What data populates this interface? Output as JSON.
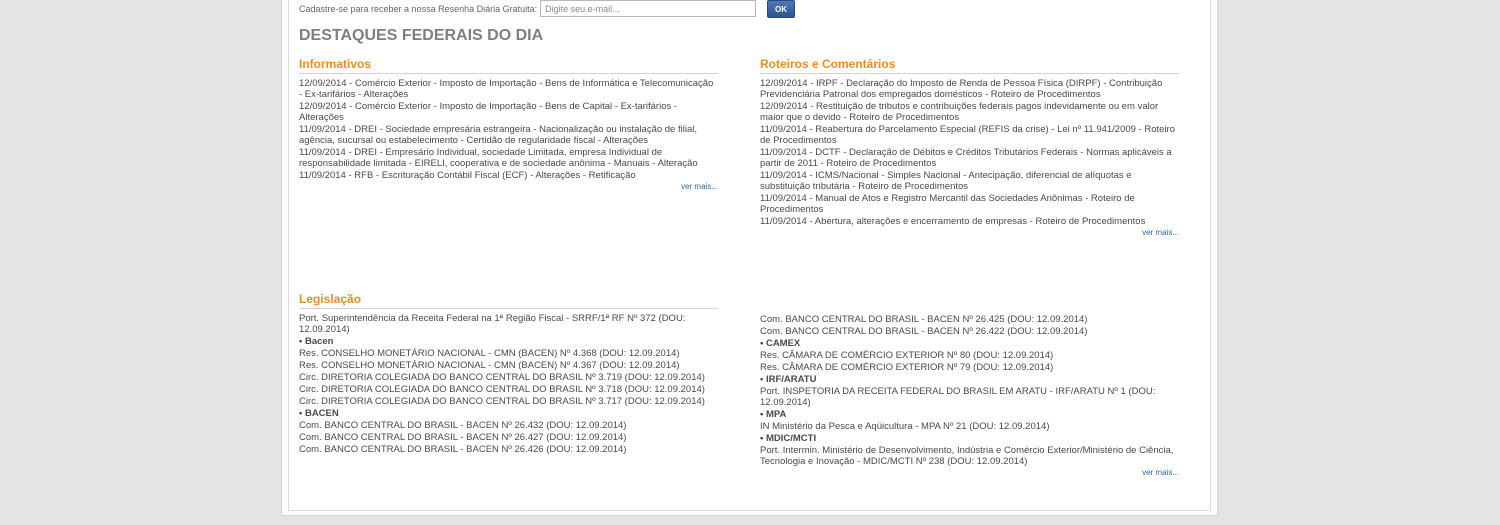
{
  "newsletter": {
    "label": "Cadastre-se para receber a nossa Resenha Diária Gratuita:",
    "placeholder": "Digite seu e-mail...",
    "ok_label": "OK"
  },
  "title": "DESTAQUES FEDERAIS DO DIA",
  "informativos": {
    "title": "Informativos",
    "items": [
      "12/09/2014 - Comércio Exterior - Imposto de Importação - Bens de Informática e Telecomunicação - Ex-tarifários - Alterações",
      "12/09/2014 - Comércio Exterior - Imposto de Importação - Bens de Capital - Ex-tarifários - Alterações",
      "11/09/2014 - DREI - Sociedade empresária estrangeira - Nacionalização ou instalação de filial, agência, sucursal ou estabelecimento - Certidão de regularidade fiscal - Alterações",
      "11/09/2014 - DREI - Empresário Individual, sociedade Limitada, empresa Individual de responsabilidade limitada - EIRELI, cooperativa e de sociedade anônima - Manuais - Alteração",
      "11/09/2014 - RFB - Escrituração Contábil Fiscal (ECF) - Alterações - Retificação"
    ],
    "more": "ver mais..."
  },
  "roteiros": {
    "title": "Roteiros e Comentários",
    "items": [
      "12/09/2014 - IRPF - Declaração do Imposto de Renda de Pessoa Física (DIRPF) - Contribuição Previdenciária Patronal dos empregados domésticos - Roteiro de Procedimentos",
      "12/09/2014 - Restituição de tributos e contribuições federais pagos indevidamente ou em valor maior que o devido - Roteiro de Procedimentos",
      "11/09/2014 - Reabertura do Parcelamento Especial (REFIS da crise) - Lei nº 11.941/2009 - Roteiro de Procedimentos",
      "11/09/2014 - DCTF - Declaração de Débitos e Créditos Tributários Federais - Normas aplicáveis a partir de 2011 - Roteiro de Procedimentos",
      "11/09/2014 - ICMS/Nacional - Simples Nacional - Antecipação, diferencial de alíquotas e substituição tributária - Roteiro de Procedimentos",
      "11/09/2014 - Manual de Atos e Registro Mercantil das Sociedades Anônimas - Roteiro de Procedimentos",
      "11/09/2014 - Abertura, alterações e encerramento de empresas - Roteiro de Procedimentos"
    ],
    "more": "ver mais..."
  },
  "legislacao": {
    "title": "Legislação",
    "left_entries": [
      {
        "kind": "item",
        "text": "Port. Superintendência da Receita Federal na 1ª Região Fiscal - SRRF/1ª RF Nº 372 (DOU: 12.09.2014)"
      },
      {
        "kind": "group",
        "text": "• Bacen"
      },
      {
        "kind": "item",
        "text": "Res. CONSELHO MONETÁRIO NACIONAL - CMN (BACEN) Nº 4.368 (DOU: 12.09.2014)"
      },
      {
        "kind": "item",
        "text": "Res. CONSELHO MONETÁRIO NACIONAL - CMN (BACEN) Nº 4.367 (DOU: 12.09.2014)"
      },
      {
        "kind": "item",
        "text": "Circ. DIRETORIA COLEGIADA DO BANCO CENTRAL DO BRASIL Nº 3.719 (DOU: 12.09.2014)"
      },
      {
        "kind": "item",
        "text": "Circ. DIRETORIA COLEGIADA DO BANCO CENTRAL DO BRASIL Nº 3.718 (DOU: 12.09.2014)"
      },
      {
        "kind": "item",
        "text": "Circ. DIRETORIA COLEGIADA DO BANCO CENTRAL DO BRASIL Nº 3.717 (DOU: 12.09.2014)"
      },
      {
        "kind": "group",
        "text": "• BACEN"
      },
      {
        "kind": "item",
        "text": "Com. BANCO CENTRAL DO BRASIL - BACEN Nº 26.432 (DOU: 12.09.2014)"
      },
      {
        "kind": "item",
        "text": "Com. BANCO CENTRAL DO BRASIL - BACEN Nº 26.427 (DOU: 12.09.2014)"
      },
      {
        "kind": "item",
        "text": "Com. BANCO CENTRAL DO BRASIL - BACEN Nº 26.426 (DOU: 12.09.2014)"
      }
    ],
    "right_entries": [
      {
        "kind": "item",
        "text": "Com. BANCO CENTRAL DO BRASIL - BACEN Nº 26.425 (DOU: 12.09.2014)"
      },
      {
        "kind": "item",
        "text": "Com. BANCO CENTRAL DO BRASIL - BACEN Nº 26.422 (DOU: 12.09.2014)"
      },
      {
        "kind": "group",
        "text": "• CAMEX"
      },
      {
        "kind": "item",
        "text": "Res. CÂMARA DE COMÉRCIO EXTERIOR Nº 80 (DOU: 12.09.2014)"
      },
      {
        "kind": "item",
        "text": "Res. CÂMARA DE COMÉRCIO EXTERIOR Nº 79 (DOU: 12.09.2014)"
      },
      {
        "kind": "group",
        "text": "• IRF/ARATU"
      },
      {
        "kind": "item",
        "text": "Port. INSPETORIA DA RECEITA FEDERAL DO BRASIL EM ARATU - IRF/ARATU Nº 1 (DOU: 12.09.2014)"
      },
      {
        "kind": "group",
        "text": "• MPA"
      },
      {
        "kind": "item",
        "text": "IN Ministério da Pesca e Aqüicultura - MPA Nº 21 (DOU: 12.09.2014)"
      },
      {
        "kind": "group",
        "text": "• MDIC/MCTI"
      },
      {
        "kind": "item",
        "text": "Port. Intermin. Ministério de Desenvolvimento, Indústria e Comércio Exterior/Ministério de Ciência, Tecnologia e Inovação - MDIC/MCTI Nº 238 (DOU: 12.09.2014)"
      }
    ],
    "more": "ver mais..."
  }
}
